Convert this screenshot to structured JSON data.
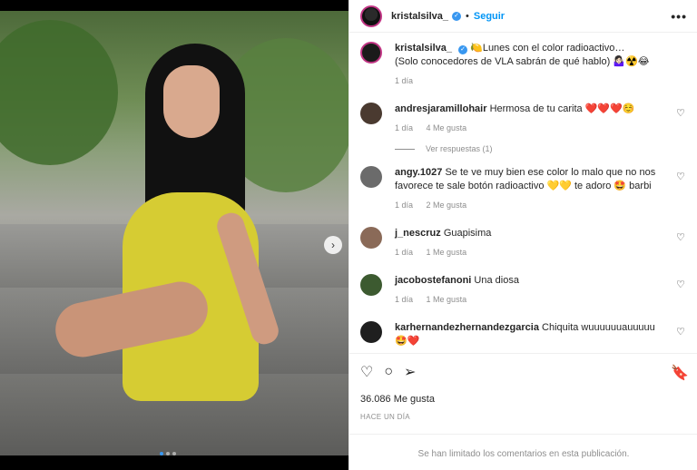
{
  "post": {
    "author": "kristalsilva_",
    "follow_label": "Seguir",
    "more_label": "•••",
    "separator": "•",
    "caption_line1": "🍋Lunes con el color radioactivo…",
    "caption_line2": "(Solo conocedores de VLA sabrán de qué hablo) 🤷🏻‍♀️☢️😂",
    "caption_time": "1 día",
    "likes": "36.086 Me gusta",
    "posted": "HACE UN DÍA",
    "limited_notice": "Se han limitado los comentarios en esta publicación."
  },
  "comments": [
    {
      "user": "andresjaramillohair",
      "text": "Hermosa de tu carita ❤️❤️❤️☺️",
      "time": "1 día",
      "likes": "4 Me gusta",
      "reply": "",
      "avatar_color": "#4a3a30"
    },
    {
      "user": "angy.1027",
      "text": "Se te ve muy bien ese color lo malo que no nos favorece te sale botón radioactivo 💛💛 te adoro 🤩 barbi",
      "time": "1 día",
      "likes": "2 Me gusta",
      "reply": "",
      "avatar_color": "#6b6b6b"
    },
    {
      "user": "j_nescruz",
      "text": "Guapisima",
      "time": "1 día",
      "likes": "1 Me gusta",
      "reply": "",
      "avatar_color": "#8a6a58"
    },
    {
      "user": "jacobostefanoni",
      "text": "Una diosa",
      "time": "1 día",
      "likes": "1 Me gusta",
      "reply": "",
      "avatar_color": "#3c5a30"
    },
    {
      "user": "karhernandezhernandezgarcia",
      "text": "Chiquita wuuuuuuauuuuu 🤩❤️",
      "time": "",
      "likes": "",
      "reply": "",
      "avatar_color": "#1f1f1f"
    }
  ],
  "view_replies": "Ver respuestas (1)",
  "icons": {
    "heart": "♡",
    "comment": "○",
    "share": "➢",
    "save": "🔖",
    "carousel_next": "›"
  },
  "colors": {
    "accent": "#0095f6",
    "verified": "#3897f0",
    "dress": "#d6cc33"
  }
}
